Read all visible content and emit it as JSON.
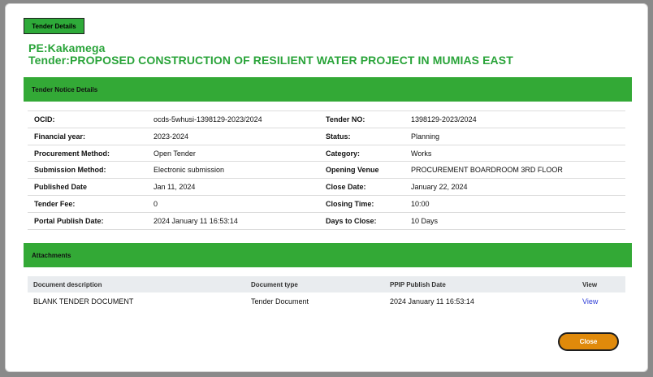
{
  "header": {
    "tab_label": "Tender Details",
    "pe": "PE:Kakamega",
    "tender": "Tender:PROPOSED CONSTRUCTION OF RESILIENT WATER PROJECT IN MUMIAS EAST"
  },
  "notice": {
    "title": "Tender Notice Details",
    "rows": [
      {
        "l1": "OCID:",
        "v1": "ocds-5whusi-1398129-2023/2024",
        "l2": "Tender NO:",
        "v2": "1398129-2023/2024"
      },
      {
        "l1": "Financial year:",
        "v1": "2023-2024",
        "l2": "Status:",
        "v2": "Planning"
      },
      {
        "l1": "Procurement Method:",
        "v1": "Open Tender",
        "l2": "Category:",
        "v2": "Works"
      },
      {
        "l1": "Submission Method:",
        "v1": "Electronic submission",
        "l2": "Opening Venue",
        "v2": "PROCUREMENT BOARDROOM 3RD FLOOR"
      },
      {
        "l1": "Published Date",
        "v1": "Jan 11, 2024",
        "l2": "Close Date:",
        "v2": "January 22, 2024"
      },
      {
        "l1": "Tender Fee:",
        "v1": "0",
        "l2": "Closing Time:",
        "v2": "10:00"
      },
      {
        "l1": "Portal Publish Date:",
        "v1": "2024 January 11 16:53:14",
        "l2": "Days to Close:",
        "v2": "10 Days"
      }
    ]
  },
  "attachments": {
    "title": "Attachments",
    "columns": [
      "Document description",
      "Document type",
      "PPIP Publish Date",
      "View"
    ],
    "rows": [
      {
        "description": "BLANK TENDER DOCUMENT",
        "type": "Tender Document",
        "date": "2024 January 11 16:53:14",
        "view": "View"
      }
    ]
  },
  "actions": {
    "close_label": "Close"
  },
  "colors": {
    "accent_green": "#33a936",
    "title_green": "#2aa43a",
    "close_orange": "#e08a0b",
    "link_blue": "#2b3ad6"
  }
}
